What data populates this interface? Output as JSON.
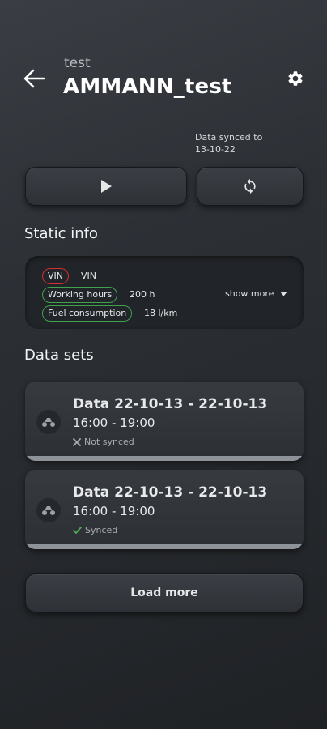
{
  "header": {
    "subtitle": "test",
    "title": "AMMANN_test",
    "sync_label": "Data synced to",
    "sync_date": "13-10-22"
  },
  "static_info": {
    "section_title": "Static info",
    "rows": [
      {
        "label": "VIN",
        "value": "VIN"
      },
      {
        "label": "Working hours",
        "value": "200 h"
      },
      {
        "label": "Fuel consumption",
        "value": "18 l/km"
      }
    ],
    "show_more": "show more"
  },
  "data_sets": {
    "section_title": "Data sets",
    "items": [
      {
        "title": "Data 22-10-13 - 22-10-13",
        "time": "16:00 - 19:00",
        "status": "Not synced",
        "status_icon": "x-icon",
        "status_color": "#a9adb2"
      },
      {
        "title": "Data 22-10-13 - 22-10-13",
        "time": "16:00 - 19:00",
        "status": "Synced",
        "status_icon": "check-icon",
        "status_color": "#4caf50"
      }
    ],
    "load_more": "Load more"
  },
  "colors": {
    "vin_border": "#d32f2f",
    "ok_border": "#3fa34d"
  }
}
